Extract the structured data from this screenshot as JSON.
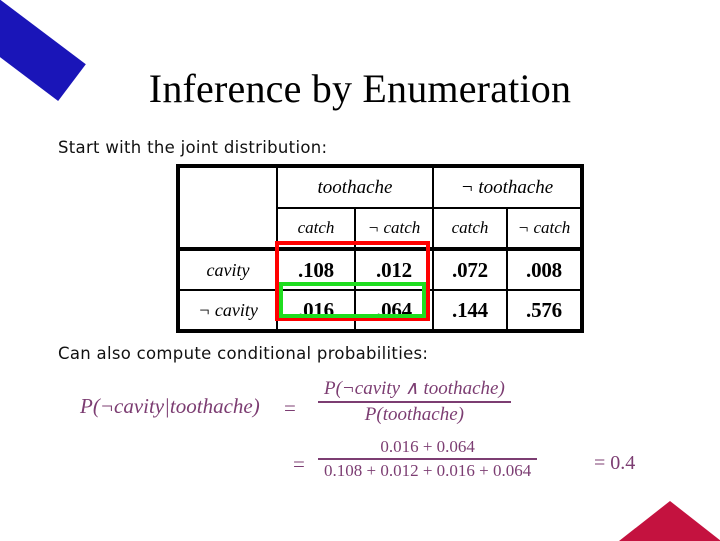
{
  "slide": {
    "title": "Inference by Enumeration",
    "intro_line": "Start with the joint distribution:",
    "conditional_line": "Can also compute conditional probabilities:"
  },
  "decorations": {
    "ribbon_color": "#1a15b8",
    "ribbon_name": "blue-diagonal-ribbon",
    "triangle_color": "#c4123f",
    "triangle_name": "red-corner-triangle"
  },
  "table": {
    "corner_blank_top": "",
    "corner_blank_sub": "",
    "group_headers": [
      "toothache",
      "¬ toothache"
    ],
    "sub_headers": [
      "catch",
      "¬ catch",
      "catch",
      "¬ catch"
    ],
    "row_labels": [
      "cavity",
      "¬ cavity"
    ],
    "rows": [
      {
        "label": "cavity",
        "values": [
          ".108",
          ".012",
          ".072",
          ".008"
        ]
      },
      {
        "label": "¬ cavity",
        "values": [
          ".016",
          ".064",
          ".144",
          ".576"
        ]
      }
    ],
    "highlights": {
      "red_box_color": "#ff0000",
      "red_box_label": "toothache-block-highlight",
      "green_box_color": "#1fdd1f",
      "green_box_label": "not-cavity-toothache-highlight"
    }
  },
  "math": {
    "color": "#7c3d72",
    "lhs": "P(¬cavity|toothache)",
    "equals_1": "=",
    "fraction_1": {
      "numerator": "P(¬cavity ∧ toothache)",
      "denominator": "P(toothache)"
    },
    "equals_2": "=",
    "fraction_2": {
      "numerator": "0.016 + 0.064",
      "denominator": "0.108 + 0.012 + 0.016 + 0.064"
    },
    "result": "= 0.4"
  }
}
